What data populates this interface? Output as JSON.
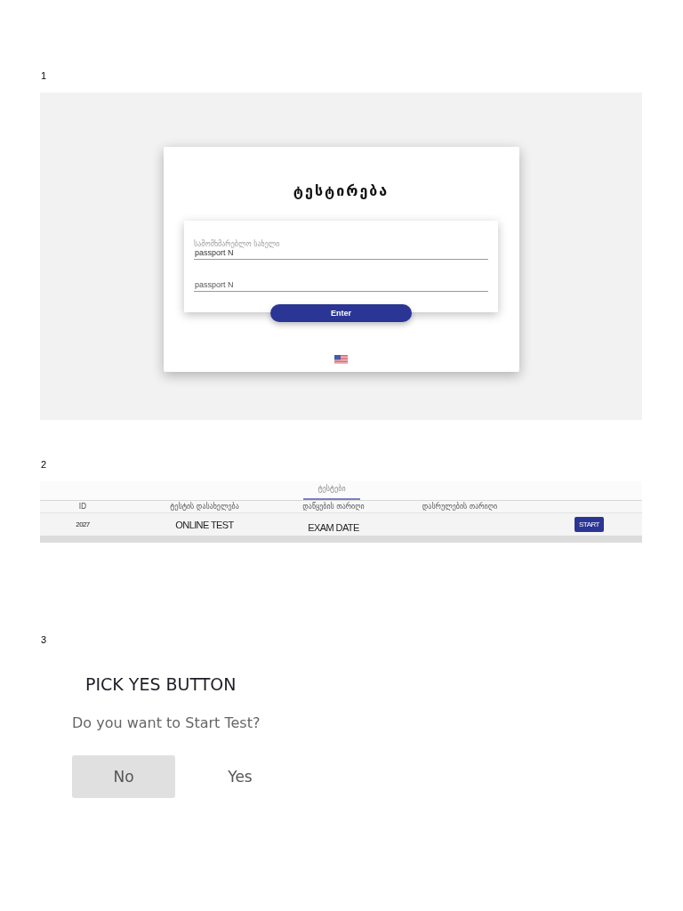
{
  "figure_1": {
    "number": "1",
    "title": "ტესტირება",
    "fields": [
      {
        "label": "სამომხმარებლო სახელი",
        "value": "passport N"
      },
      {
        "placeholder": "passport N"
      }
    ],
    "button": "Enter"
  },
  "figure_2": {
    "number": "2",
    "tabs": [
      {
        "label": "ტესტები",
        "selected": true
      }
    ],
    "table": {
      "columns": [
        "ID",
        "ტესტის დასახელება",
        "დაწყების თარიღი",
        "დასრულების თარიღი"
      ],
      "rows": [
        {
          "id": "2027",
          "name": "ONLINE TEST",
          "exam_date": "EXAM DATE",
          "action": "START"
        }
      ]
    }
  },
  "figure_3": {
    "number": "3",
    "heading": "PICK YES BUTTON",
    "question": "Do you want to Start Test?",
    "buttons": [
      {
        "label": "No",
        "highlighted": true
      },
      {
        "label": "Yes",
        "highlighted": false
      }
    ]
  }
}
